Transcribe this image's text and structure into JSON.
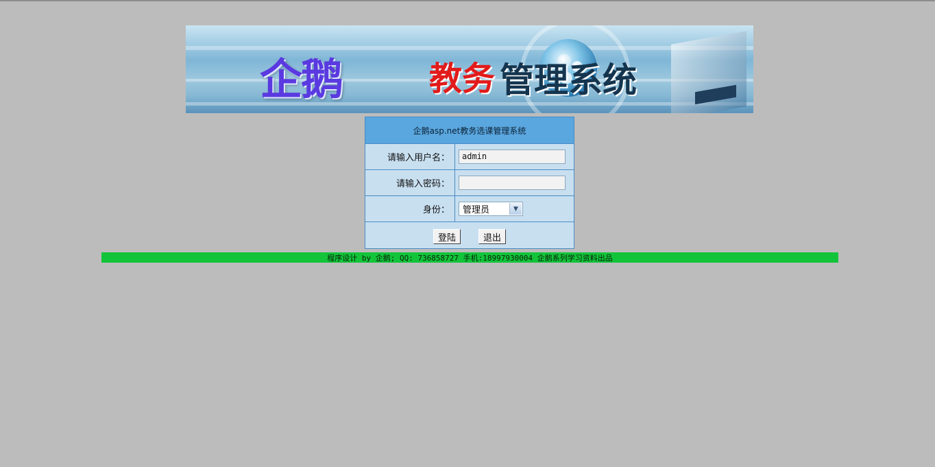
{
  "banner": {
    "brand": "企鹅",
    "title_red": "教务",
    "title_dark": "管理系统"
  },
  "login": {
    "title": "企鹅asp.net教务选课管理系统",
    "username_label": "请输入用户名：",
    "username_value": "admin",
    "password_label": "请输入密码：",
    "password_value": "",
    "role_label": "身份：",
    "role_selected": "管理员",
    "login_button": "登陆",
    "exit_button": "退出"
  },
  "footer": {
    "text": "程序设计 by 企鹅; QQ: 736858727 手机:18997930004 企鹅系列学习资料出品"
  },
  "colors": {
    "background": "#bcbcbc",
    "panel_header": "#5aa6de",
    "panel_body": "#c8dff0",
    "footer_bar": "#12c43a"
  }
}
